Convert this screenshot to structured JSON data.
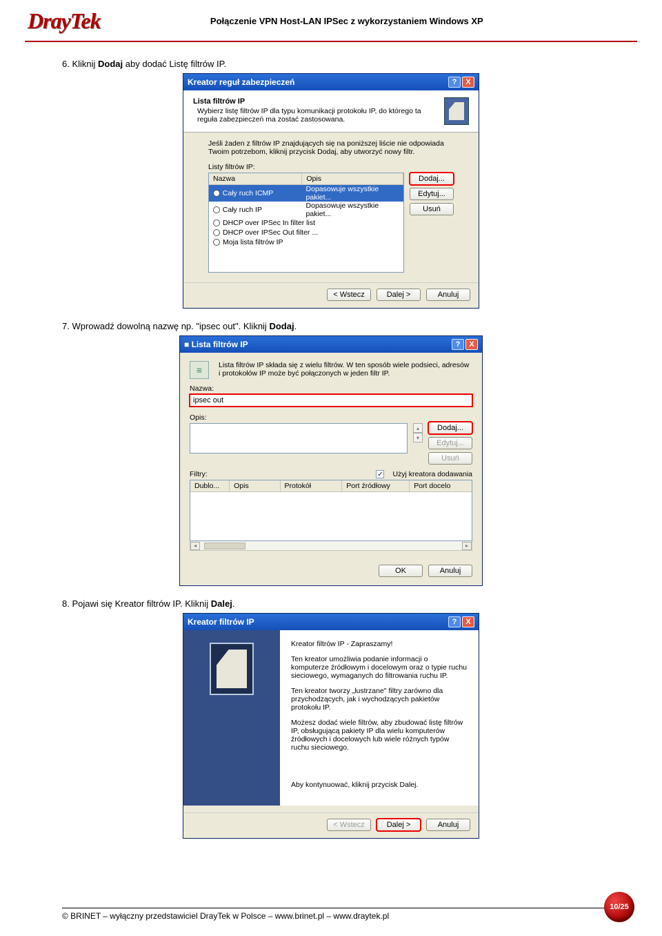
{
  "header": {
    "logo": "DrayTek",
    "title": "Połączenie VPN Host-LAN IPSec z wykorzystaniem Windows XP"
  },
  "step6": {
    "prefix": "6. Kliknij ",
    "bold": "Dodaj",
    "suffix": " aby dodać Listę filtrów IP."
  },
  "dlg1": {
    "title": "Kreator reguł zabezpieczeń",
    "head_title": "Lista filtrów IP",
    "head_sub": "Wybierz listę filtrów IP dla typu komunikacji protokołu IP, do którego ta reguła zabezpieczeń ma zostać zastosowana.",
    "note": "Jeśli żaden z filtrów IP znajdujących się na poniższej liście nie odpowiada Twoim potrzebom, kliknij przycisk Dodaj, aby utworzyć nowy filtr.",
    "list_label": "Listy filtrów IP:",
    "col_name": "Nazwa",
    "col_desc": "Opis",
    "rows": [
      {
        "name": "Cały ruch ICMP",
        "desc": "Dopasowuje wszystkie pakiet...",
        "sel": true
      },
      {
        "name": "Cały ruch IP",
        "desc": "Dopasowuje wszystkie pakiet...",
        "sel": false
      },
      {
        "name": "DHCP over IPSec In filter list",
        "desc": "",
        "sel": false
      },
      {
        "name": "DHCP over IPSec Out filter ...",
        "desc": "",
        "sel": false
      },
      {
        "name": "Moja lista filtrów IP",
        "desc": "",
        "sel": false
      }
    ],
    "btn_add": "Dodaj...",
    "btn_edit": "Edytuj...",
    "btn_del": "Usuń",
    "btn_back": "< Wstecz",
    "btn_next": "Dalej >",
    "btn_cancel": "Anuluj"
  },
  "step7": {
    "prefix": "7. Wprowadź dowolną nazwę np. \"ipsec out\". Kliknij ",
    "bold": "Dodaj",
    "suffix": "."
  },
  "dlg2": {
    "title": "Lista filtrów IP",
    "desc": "Lista filtrów IP składa się z wielu filtrów. W ten sposób wiele podsieci, adresów i protokołów IP może być połączonych w jeden filtr IP.",
    "label_name": "Nazwa:",
    "name_value": "ipsec out",
    "label_desc": "Opis:",
    "btn_add": "Dodaj...",
    "btn_edit": "Edytuj...",
    "btn_del": "Usuń",
    "chk_label": "Użyj kreatora dodawania",
    "filters_label": "Filtry:",
    "col_dup": "Dublo...",
    "col_desc": "Opis",
    "col_proto": "Protokół",
    "col_src": "Port źródłowy",
    "col_dst": "Port docelo",
    "btn_ok": "OK",
    "btn_cancel": "Anuluj"
  },
  "step8": {
    "prefix": "8. Pojawi się Kreator filtrów IP. Kliknij ",
    "bold": "Dalej",
    "suffix": "."
  },
  "dlg3": {
    "title": "Kreator filtrów IP",
    "h": "Kreator filtrów IP - Zapraszamy!",
    "p1": "Ten kreator umożliwia podanie informacji o komputerze źródłowym i docelowym oraz o typie ruchu sieciowego, wymaganych do filtrowania ruchu IP.",
    "p2": "Ten kreator tworzy „lustrzane\" filtry zarówno dla przychodzących, jak i wychodzących pakietów protokołu IP.",
    "p3": "Możesz dodać wiele filtrów, aby zbudować listę filtrów IP, obsługującą pakiety IP dla wielu komputerów źródłowych i docelowych lub wiele różnych typów ruchu sieciowego.",
    "p4": "Aby kontynuować, kliknij przycisk Dalej.",
    "btn_back": "< Wstecz",
    "btn_next": "Dalej >",
    "btn_cancel": "Anuluj"
  },
  "footer": {
    "text": "© BRINET – wyłączny przedstawiciel DrayTek w Polsce – www.brinet.pl – www.draytek.pl",
    "page": "10/25"
  },
  "tbicons": {
    "help": "?",
    "close": "X"
  }
}
